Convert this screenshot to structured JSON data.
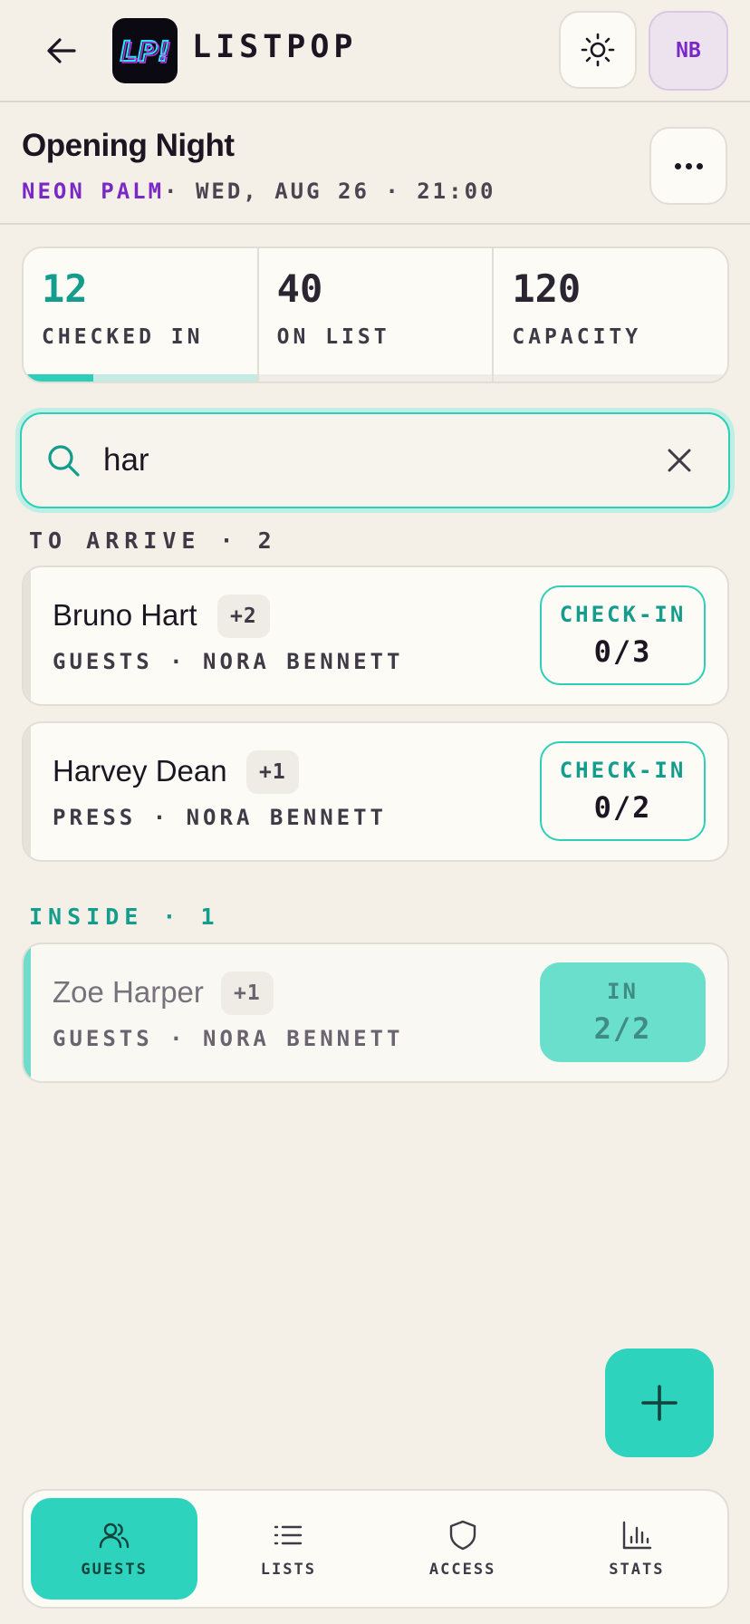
{
  "app": {
    "brand": "LISTPOP",
    "logo_text": "LP!",
    "user_initials": "NB"
  },
  "event": {
    "title": "Opening Night",
    "venue": "NEON PALM",
    "meta": "· WED, AUG 26 · 21:00"
  },
  "stats": [
    {
      "value": "12",
      "label": "CHECKED IN",
      "progress": 0.3
    },
    {
      "value": "40",
      "label": "ON LIST"
    },
    {
      "value": "120",
      "label": "CAPACITY"
    }
  ],
  "search": {
    "value": "har"
  },
  "sections": {
    "to_arrive": "TO ARRIVE · 2",
    "inside": "INSIDE · 1"
  },
  "guests": [
    {
      "name": "Bruno Hart",
      "plus": "+2",
      "sub": "GUESTS · NORA BENNETT",
      "action": "CHECK-IN",
      "count": "0/3"
    },
    {
      "name": "Harvey Dean",
      "plus": "+1",
      "sub": "PRESS · NORA BENNETT",
      "action": "CHECK-IN",
      "count": "0/2"
    },
    {
      "name": "Zoe Harper",
      "plus": "+1",
      "sub": "GUESTS · NORA BENNETT",
      "action": "IN",
      "count": "2/2"
    }
  ],
  "nav": [
    {
      "label": "GUESTS",
      "icon": "users-icon"
    },
    {
      "label": "LISTS",
      "icon": "list-icon"
    },
    {
      "label": "ACCESS",
      "icon": "shield-icon"
    },
    {
      "label": "STATS",
      "icon": "bar-chart-icon"
    }
  ],
  "colors": {
    "accent": "#2ed3bd",
    "brand_purple": "#7a28c6",
    "background": "#f4f0e8"
  }
}
